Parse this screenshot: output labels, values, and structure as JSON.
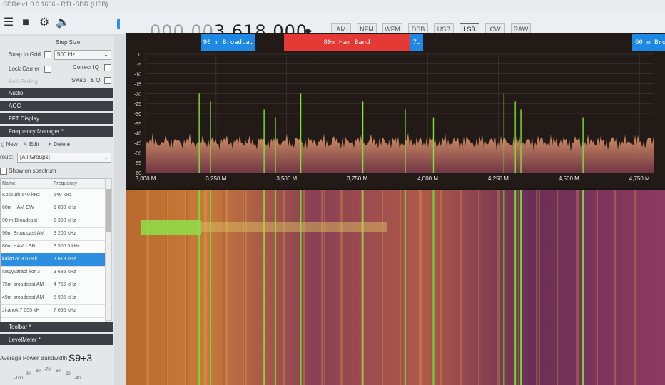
{
  "titlebar": {
    "text": "SDR# v1.0.0.1666 - RTL-SDR (USB)"
  },
  "toolbar": {
    "icons": [
      "hamburger-menu-icon",
      "stop-icon",
      "gear-icon",
      "speaker-icon"
    ],
    "frequency_dim": "000.00",
    "frequency_main": "3.618.000",
    "frequency_arrows": "◂▸",
    "modes": [
      {
        "label": "AM",
        "active": false
      },
      {
        "label": "NFM",
        "active": false
      },
      {
        "label": "WFM",
        "active": false
      },
      {
        "label": "DSB",
        "active": false
      },
      {
        "label": "USB",
        "active": false
      },
      {
        "label": "LSB",
        "active": true
      },
      {
        "label": "CW",
        "active": false
      },
      {
        "label": "RAW",
        "active": false
      }
    ]
  },
  "radio": {
    "step_size_label": "Step Size",
    "snap_to_grid": "Snap to Grid",
    "step_size_value": "500 Hz",
    "lock_carrier": "Lock Carrier",
    "correct_iq": "Correct IQ",
    "anti_fading": "Anti-Fading",
    "swap_iq": "Swap I & Q"
  },
  "sections": {
    "audio": "Audio",
    "agc": "AGC",
    "fft": "FFT Display",
    "freq_manager": "Frequency Manager *",
    "toolbar": "Toolbar *",
    "levelmeter": "LevelMeter *"
  },
  "freq_manager": {
    "new_label": "New",
    "edit_label": "Edit",
    "delete_label": "Delete",
    "group_label": "roup:",
    "group_value": "[All Groups]",
    "show_on_spectrum": "Show on spectrum",
    "col_name": "Name",
    "col_frequency": "Frequency",
    "rows": [
      {
        "name": "Kossuth 540 kHz",
        "freq": "540 kHz",
        "selected": false
      },
      {
        "name": "60m HAM CW",
        "freq": "1 800 kHz",
        "selected": false
      },
      {
        "name": "90 m Broadcast",
        "freq": "2 300 kHz",
        "selected": false
      },
      {
        "name": "90m Broadcast AM",
        "freq": "3 200 kHz",
        "selected": false
      },
      {
        "name": "80m HAM LSB",
        "freq": "3 500.5 kHz",
        "selected": false
      },
      {
        "name": "kaiko or 3 618 k",
        "freq": "3 618 kHz",
        "selected": true
      },
      {
        "name": "Nagyváradi kör 3",
        "freq": "3 685 kHz",
        "selected": false
      },
      {
        "name": "75m broadcast AM",
        "freq": "4 755 kHz",
        "selected": false
      },
      {
        "name": "49m broadcast AM",
        "freq": "5 905 kHz",
        "selected": false
      },
      {
        "name": "Jiránok 7 055 kH",
        "freq": "7 055 kHz",
        "selected": false
      }
    ]
  },
  "levelmeter": {
    "label": "Average Power Bandwidth",
    "value": "S9+3",
    "scale": [
      "-100",
      "-90",
      "-80",
      "-70",
      "-60",
      "-50",
      "-40"
    ]
  },
  "bookmarks": [
    {
      "label": "90 m Broadca…",
      "color": "#1e88e5"
    },
    {
      "label": "80m Ham Band",
      "color": "#e53935"
    },
    {
      "label": "7…",
      "color": "#1e88e5"
    },
    {
      "label": "60 m Bro…",
      "color": "#1e88e5"
    }
  ],
  "spectrum": {
    "y_ticks": [
      "0",
      "-5",
      "-10",
      "-15",
      "-20",
      "-25",
      "-30",
      "-35",
      "-40",
      "-45",
      "-50",
      "-55",
      "-60"
    ],
    "x_ticks": [
      "3,000 M",
      "3,250 M",
      "3,500 M",
      "3,750 M",
      "4,000 M",
      "4,250 M",
      "4,500 M",
      "4,750 M"
    ],
    "tuned_freq_mhz": 3.618,
    "floor_db": -46,
    "peaks_mhz": [
      3.19,
      3.23,
      3.42,
      3.46,
      3.55,
      3.77,
      3.92,
      4.02,
      4.27,
      4.31,
      4.33,
      4.55
    ]
  }
}
